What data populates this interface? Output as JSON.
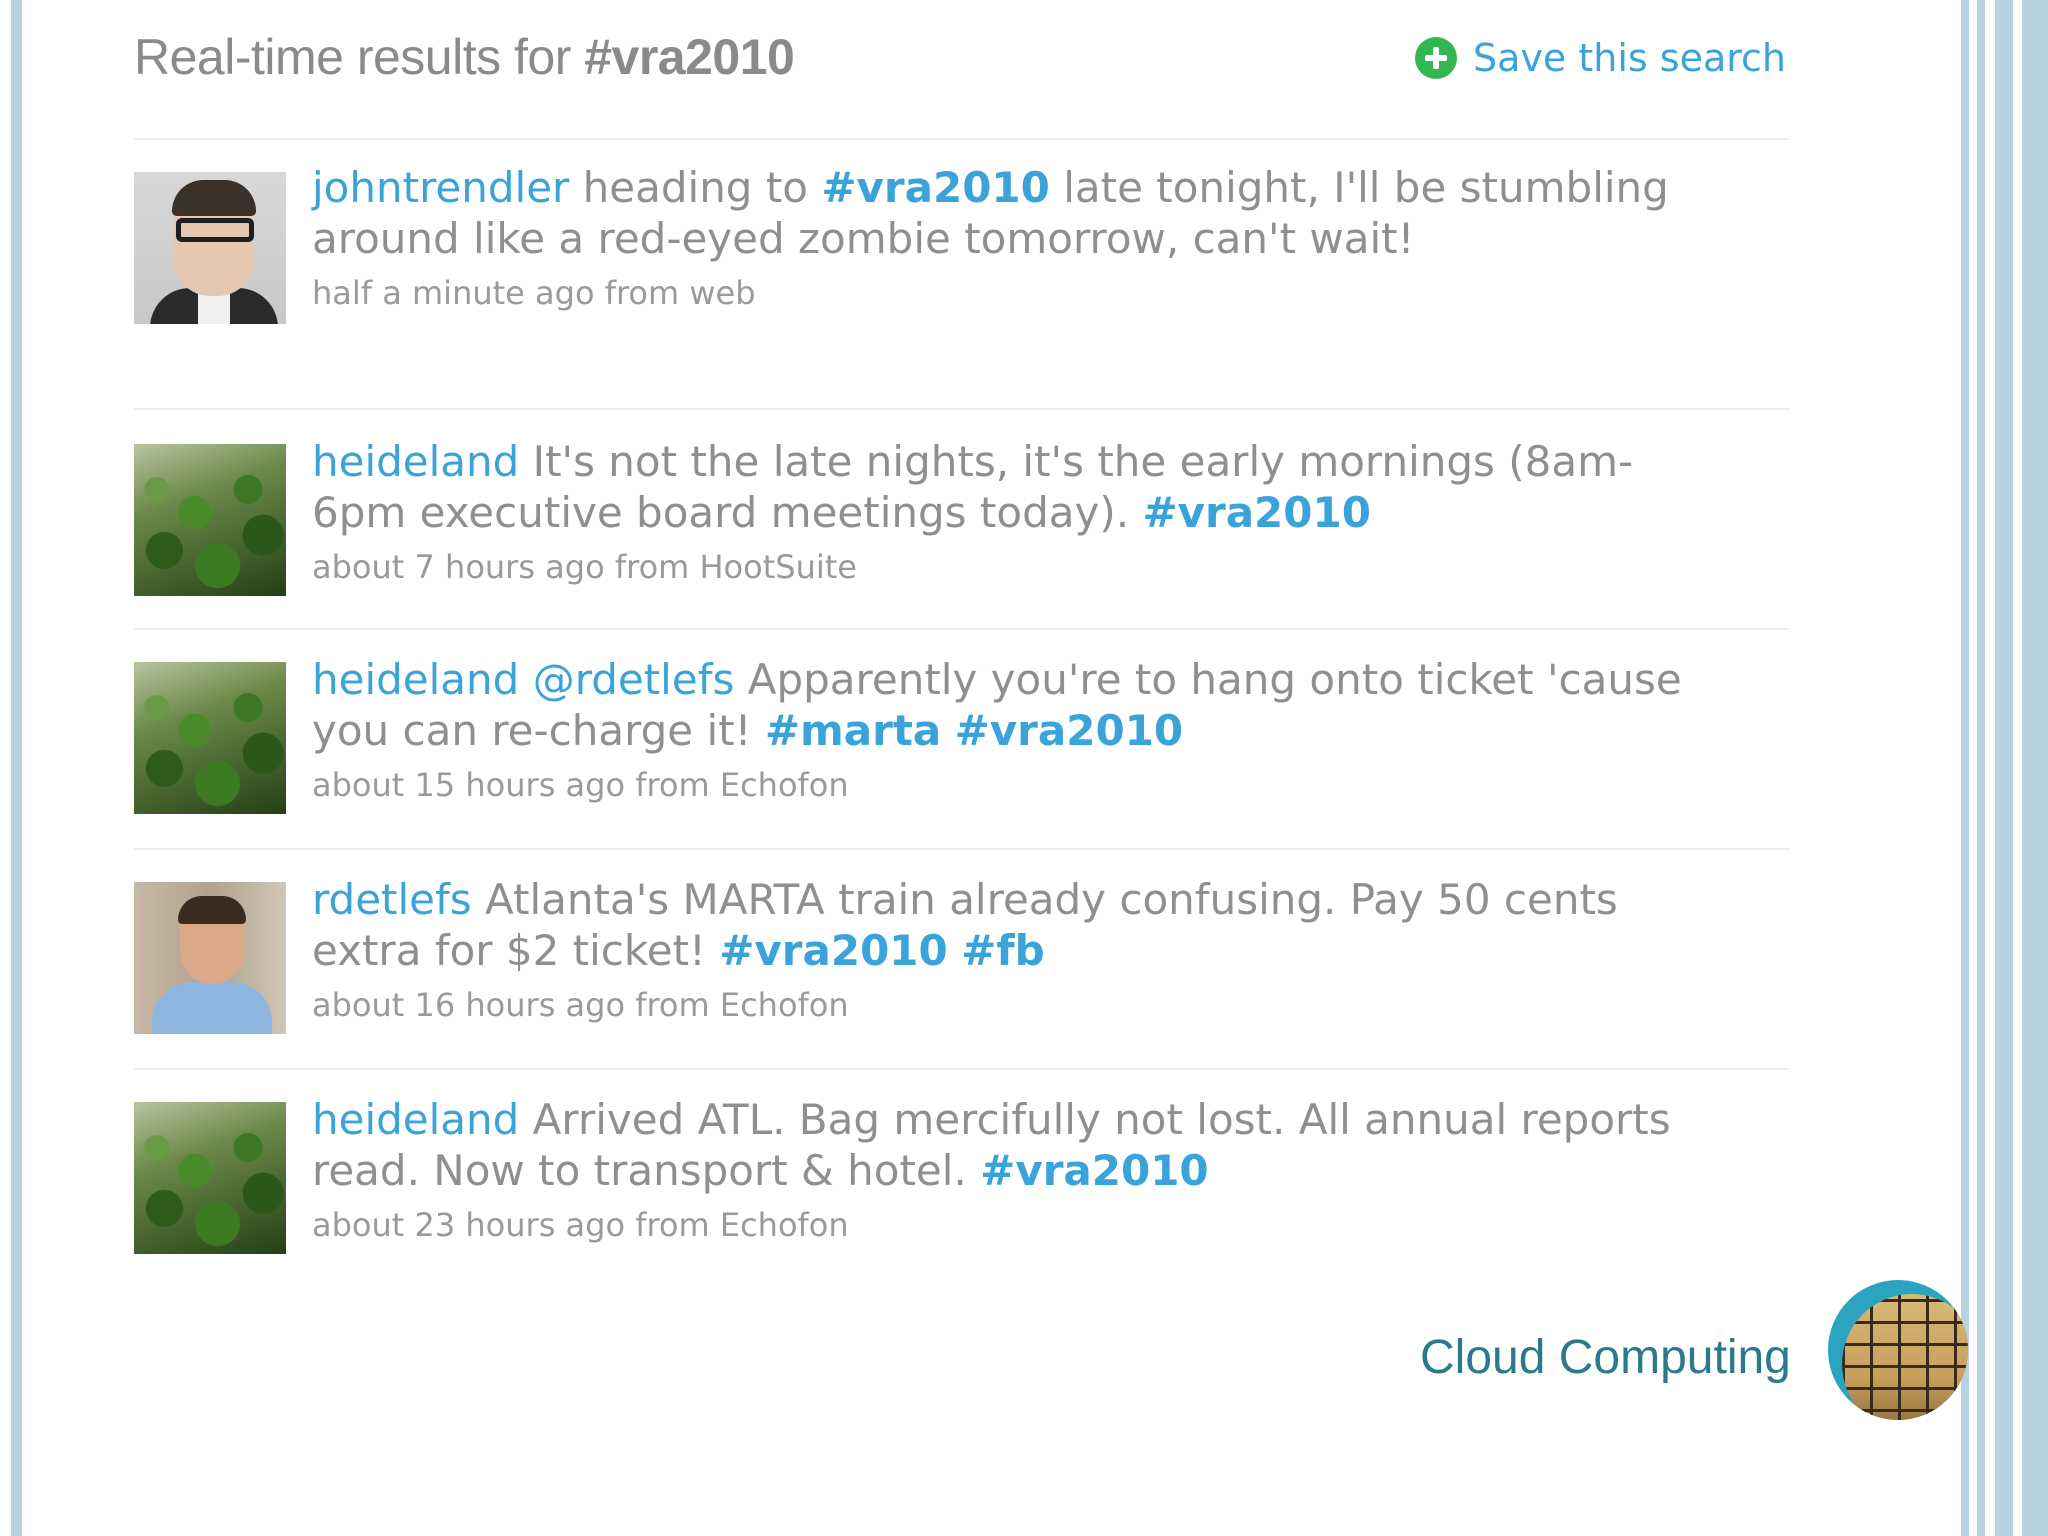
{
  "header": {
    "title_prefix": "Real-time results for ",
    "title_tag": "#vra2010",
    "save_label": "Save this search"
  },
  "tweets": [
    {
      "user": "johntrendler",
      "avatar": "man-with-glasses-avatar",
      "parts": [
        {
          "type": "text",
          "value": " heading to "
        },
        {
          "type": "hashtag",
          "value": "#vra2010"
        },
        {
          "type": "text",
          "value": " late tonight, I'll be stumbling around like a red-eyed zombie tomorrow, can't wait!"
        }
      ],
      "meta": "half a minute ago from web"
    },
    {
      "user": "heideland",
      "avatar": "green-foliage-avatar",
      "parts": [
        {
          "type": "text",
          "value": " It's not the late nights, it's the early mornings (8am-6pm executive board meetings today). "
        },
        {
          "type": "hashtag",
          "value": "#vra2010"
        }
      ],
      "meta": "about 7 hours ago from HootSuite"
    },
    {
      "user": "heideland",
      "avatar": "green-foliage-avatar",
      "parts": [
        {
          "type": "text",
          "value": " "
        },
        {
          "type": "mention",
          "value": "@rdetlefs"
        },
        {
          "type": "text",
          "value": " Apparently you're to hang onto ticket 'cause you can re-charge it! "
        },
        {
          "type": "hashtag",
          "value": "#marta"
        },
        {
          "type": "text",
          "value": " "
        },
        {
          "type": "hashtag",
          "value": "#vra2010"
        }
      ],
      "meta": "about 15 hours ago from Echofon"
    },
    {
      "user": "rdetlefs",
      "avatar": "man-blue-shirt-avatar",
      "parts": [
        {
          "type": "text",
          "value": " Atlanta's MARTA train already confusing. Pay 50 cents extra for $2 ticket! "
        },
        {
          "type": "hashtag",
          "value": "#vra2010"
        },
        {
          "type": "text",
          "value": " "
        },
        {
          "type": "hashtag",
          "value": "#fb"
        }
      ],
      "meta": "about 16 hours ago from Echofon"
    },
    {
      "user": "heideland",
      "avatar": "green-foliage-avatar",
      "parts": [
        {
          "type": "text",
          "value": " Arrived ATL. Bag mercifully not lost. All annual reports read. Now to transport & hotel. "
        },
        {
          "type": "hashtag",
          "value": "#vra2010"
        }
      ],
      "meta": "about 23 hours ago from Echofon"
    }
  ],
  "footer": {
    "label": "Cloud Computing",
    "logo_icon": "brick-wall-logo-icon"
  },
  "colors": {
    "link": "#3aa3d9",
    "text": "#8f8f8f",
    "border": "#b8d2df",
    "footer_text": "#2a7a8c"
  }
}
